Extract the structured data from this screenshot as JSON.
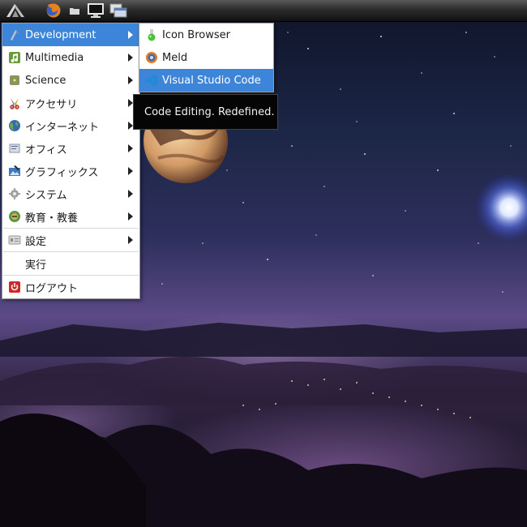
{
  "main_menu": {
    "items": [
      {
        "label": "Development",
        "icon": "development-icon",
        "has_submenu": true,
        "active": true
      },
      {
        "label": "Multimedia",
        "icon": "multimedia-icon",
        "has_submenu": true
      },
      {
        "label": "Science",
        "icon": "science-icon",
        "has_submenu": true
      },
      {
        "label": "アクセサリ",
        "icon": "accessories-icon",
        "has_submenu": true
      },
      {
        "label": "インターネット",
        "icon": "internet-icon",
        "has_submenu": true
      },
      {
        "label": "オフィス",
        "icon": "office-icon",
        "has_submenu": true
      },
      {
        "label": "グラフィックス",
        "icon": "graphics-icon",
        "has_submenu": true
      },
      {
        "label": "システム",
        "icon": "system-icon",
        "has_submenu": true
      },
      {
        "label": "教育・教養",
        "icon": "education-icon",
        "has_submenu": true
      },
      {
        "label": "設定",
        "icon": "settings-icon",
        "has_submenu": true
      },
      {
        "label": "実行",
        "icon": "",
        "has_submenu": false
      },
      {
        "label": "ログアウト",
        "icon": "logout-icon",
        "has_submenu": false
      }
    ]
  },
  "sub_menu": {
    "items": [
      {
        "label": "Icon Browser",
        "icon": "icon-browser-icon"
      },
      {
        "label": "Meld",
        "icon": "meld-icon"
      },
      {
        "label": "Visual Studio Code",
        "icon": "vscode-icon",
        "active": true
      }
    ]
  },
  "tooltip": {
    "text": "Code Editing. Redefined."
  },
  "colors": {
    "highlight": "#3d85d8",
    "tooltip_bg": "#050505",
    "panel": "#2c2c2c"
  }
}
